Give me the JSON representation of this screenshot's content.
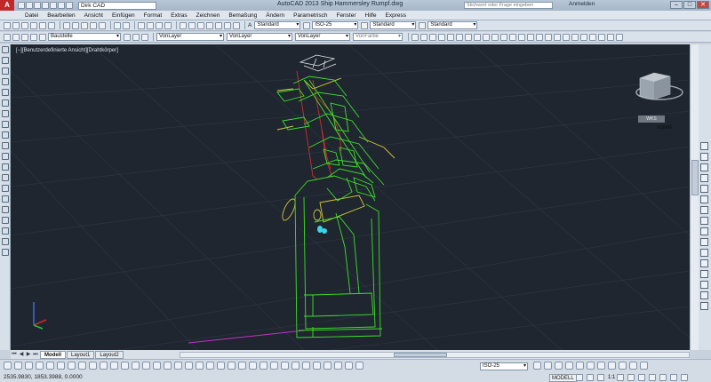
{
  "titlebar": {
    "app_logo": "A",
    "workspace": "Dirk CAD",
    "title": "AutoCAD 2013   Ship Hammersley Rumpf.dwg",
    "search_placeholder": "Stichwort oder Frage eingeben",
    "login": "Anmelden"
  },
  "menu": [
    "Datei",
    "Bearbeiten",
    "Ansicht",
    "Einfügen",
    "Format",
    "Extras",
    "Zeichnen",
    "Bemaßung",
    "Ändern",
    "Parametrisch",
    "Fenster",
    "Hilfe",
    "Express"
  ],
  "toolbar1": {
    "textstyle": "Standard",
    "dimstyle": "ISO-25",
    "tablestyle": "Standard",
    "mleaderstyle": "Standard"
  },
  "toolbar2": {
    "layer": "Baustelle",
    "color": "VonLayer",
    "linetype": "VonLayer",
    "lineweight": "VonLayer",
    "plotstyle": "VonFarbe"
  },
  "viewport": {
    "label": "[−][Benutzerdefinierte Ansicht][Drahtkörper]",
    "cube_left": "LINKS",
    "cube_front": "VORNE",
    "wcs": "WKS"
  },
  "tabs": [
    "Modell",
    "Layout1",
    "Layout2"
  ],
  "status": {
    "coords": "2535.9830, 1853.3988, 0.0000",
    "dimstyle": "ISO-25",
    "model": "MODELL",
    "scale": "1:1"
  },
  "colors": {
    "viewport_bg": "#1f2630",
    "lines_green": "#3ee02a",
    "lines_yellow": "#d4c83a",
    "lines_red": "#c8322a",
    "lines_magenta": "#c232c8"
  }
}
